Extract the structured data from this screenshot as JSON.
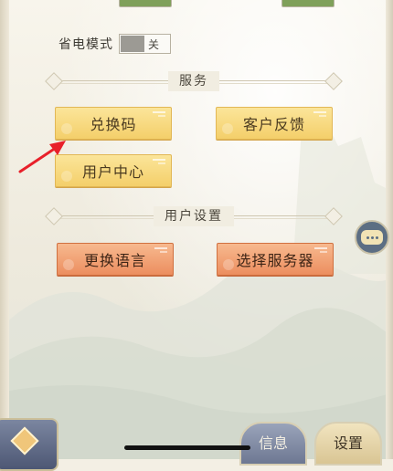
{
  "settings": {
    "power_saving": {
      "label": "省电模式",
      "state": "关"
    }
  },
  "sections": {
    "service": {
      "title": "服务",
      "buttons": {
        "redeem_code": "兑换码",
        "customer_feedback": "客户反馈",
        "user_center": "用户中心"
      }
    },
    "user_settings": {
      "title": "用户设置",
      "buttons": {
        "change_language": "更换语言",
        "select_server": "选择服务器"
      }
    }
  },
  "bottom_nav": {
    "info": "信息",
    "settings": "设置"
  },
  "colors": {
    "yellow_button": "#f4cf6a",
    "orange_button": "#ec8e5f",
    "toggle_on": "#7fa05a",
    "arrow": "#e8202a"
  },
  "icons": {
    "chat": "chat-bubble-icon",
    "corner": "diamond-gem-icon"
  }
}
